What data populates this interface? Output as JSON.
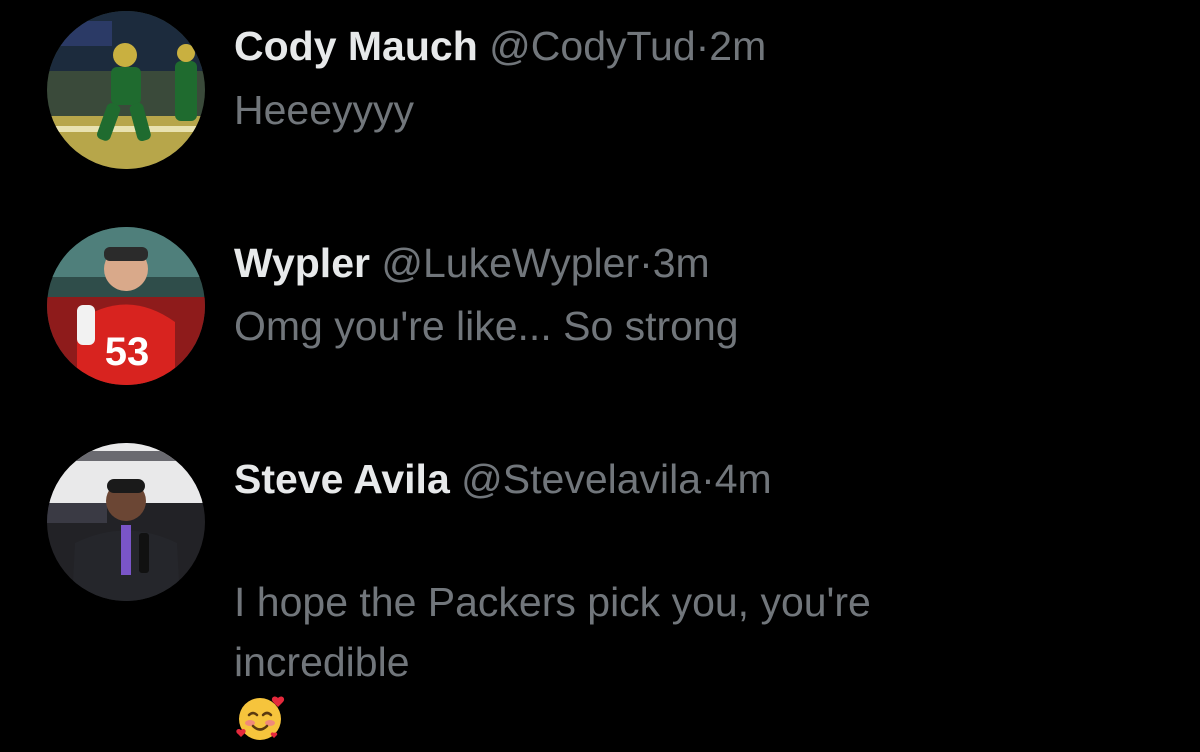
{
  "replies": [
    {
      "name": "Cody Mauch",
      "handle": "@CodyTud",
      "separator": "·",
      "time": "2m",
      "text": "Heeeyyyy",
      "avatar_icon": "football-player-green-jersey-avatar"
    },
    {
      "name": "Wypler",
      "handle": "@LukeWypler",
      "separator": "·",
      "time": "3m",
      "text": "Omg you're like... So strong",
      "avatar_icon": "football-player-red-53-jersey-avatar",
      "jersey_number": "53"
    },
    {
      "name": "Steve Avila",
      "handle": "@Stevelavila",
      "separator": "·",
      "time": "4m",
      "text": "I hope the Packers pick you, you're\nincredible",
      "emoji": "smiling-face-with-hearts"
    }
  ],
  "colors": {
    "background": "#000000",
    "name": "#e7e9ea",
    "secondary": "#71767b"
  }
}
